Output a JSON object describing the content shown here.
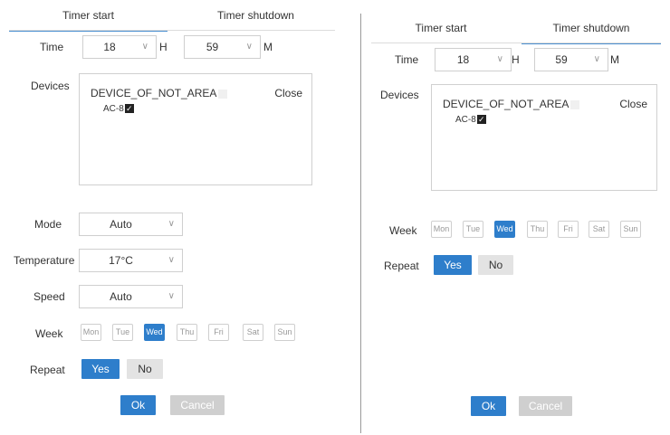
{
  "left": {
    "tabs": [
      "Timer start",
      "Timer shutdown"
    ],
    "time_label": "Time",
    "hour": "18",
    "hour_unit": "H",
    "minute": "59",
    "minute_unit": "M",
    "devices_label": "Devices",
    "device_group": "DEVICE_OF_NOT_AREA",
    "close_label": "Close",
    "device_item": "AC-8",
    "mode_label": "Mode",
    "mode_value": "Auto",
    "temperature_label": "Temperature",
    "temperature_value": "17°C",
    "speed_label": "Speed",
    "speed_value": "Auto",
    "week_label": "Week",
    "days": [
      "Mon",
      "Tue",
      "Wed",
      "Thu",
      "Fri",
      "Sat",
      "Sun"
    ],
    "repeat_label": "Repeat",
    "yes_label": "Yes",
    "no_label": "No",
    "ok_label": "Ok",
    "cancel_label": "Cancel"
  },
  "right": {
    "tabs": [
      "Timer start",
      "Timer shutdown"
    ],
    "time_label": "Time",
    "hour": "18",
    "hour_unit": "H",
    "minute": "59",
    "minute_unit": "M",
    "devices_label": "Devices",
    "device_group": "DEVICE_OF_NOT_AREA",
    "close_label": "Close",
    "device_item": "AC-8",
    "week_label": "Week",
    "days": [
      "Mon",
      "Tue",
      "Wed",
      "Thu",
      "Fri",
      "Sat",
      "Sun"
    ],
    "repeat_label": "Repeat",
    "yes_label": "Yes",
    "no_label": "No",
    "ok_label": "Ok",
    "cancel_label": "Cancel"
  },
  "icons": {
    "dropdown": "chevron-down-icon",
    "checkbox": "checkmark-icon"
  },
  "colors": {
    "accent": "#2e7ecb",
    "tab_underline": "#4a8fd1"
  }
}
